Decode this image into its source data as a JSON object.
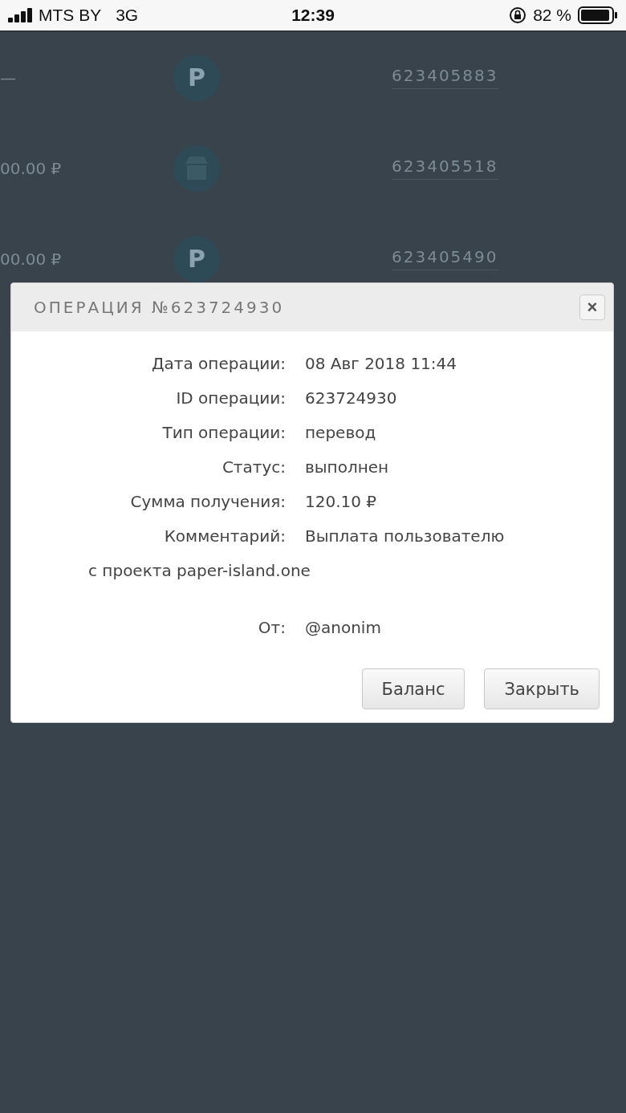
{
  "status_bar": {
    "carrier": "MTS BY",
    "network": "3G",
    "time": "12:39",
    "battery": "82 %"
  },
  "background_rows": [
    {
      "amount": "—",
      "kind": "glyph",
      "glyph": "P",
      "id": "623405883"
    },
    {
      "amount": "00.00 ₽",
      "kind": "shop",
      "id": "623405518"
    },
    {
      "amount": "00.00 ₽",
      "kind": "glyph",
      "glyph": "P",
      "id": "623405490"
    }
  ],
  "modal": {
    "title": "ОПЕРАЦИЯ №623724930",
    "close": "×",
    "fields": [
      {
        "label": "Дата операции:",
        "value": "08 Авг 2018 11:44"
      },
      {
        "label": "ID операции:",
        "value": "623724930"
      },
      {
        "label": "Тип операции:",
        "value": "перевод"
      },
      {
        "label": "Статус:",
        "value": "выполнен"
      },
      {
        "label": "Сумма получения:",
        "value": "120.10 ₽"
      },
      {
        "label": "Комментарий:",
        "value": "Выплата пользователю",
        "continuation": "с проекта paper-island.one"
      },
      {
        "label": "От:",
        "value": "@anonim",
        "kind": "spaced"
      }
    ],
    "buttons": [
      "Баланс",
      "Закрыть"
    ]
  }
}
